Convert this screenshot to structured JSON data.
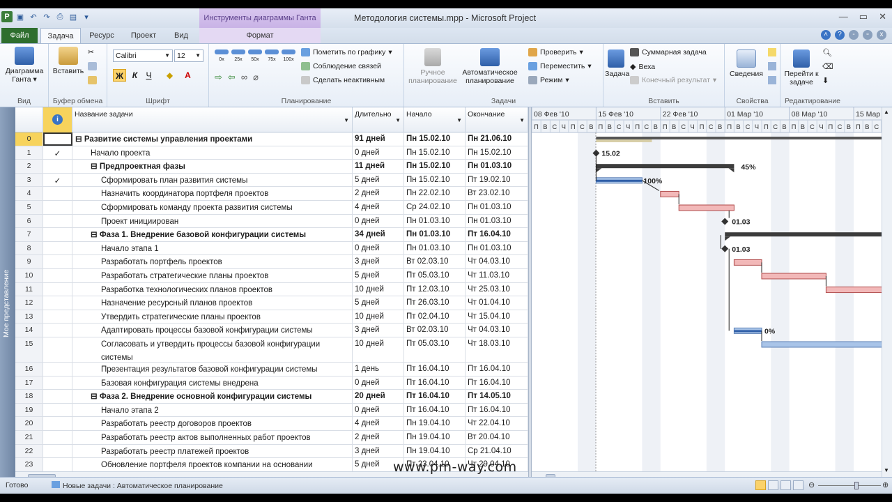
{
  "window": {
    "title": "Методология системы.mpp - Microsoft Project",
    "context_tab_group": "Инструменты диаграммы Ганта"
  },
  "tabs": {
    "file": "Файл",
    "items": [
      "Задача",
      "Ресурс",
      "Проект",
      "Вид",
      "Формат"
    ]
  },
  "ribbon": {
    "view": {
      "btn": "Диаграмма Ганта",
      "label": "Вид"
    },
    "clipboard": {
      "paste": "Вставить",
      "label": "Буфер обмена"
    },
    "font": {
      "name": "Calibri",
      "size": "12",
      "label": "Шрифт",
      "bold": "Ж",
      "italic": "К",
      "underline": "Ч"
    },
    "schedule": {
      "pct": [
        "0x",
        "25x",
        "50x",
        "75x",
        "100x"
      ],
      "mark": "Пометить по графику",
      "respect": "Соблюдение связей",
      "inactive": "Сделать неактивным",
      "label": "Планирование"
    },
    "tasks": {
      "manual": "Ручное планирование",
      "auto": "Автоматическое планирование",
      "inspect": "Проверить",
      "move": "Переместить",
      "mode": "Режим",
      "label": "Задачи"
    },
    "insert": {
      "task": "Задача",
      "summary": "Суммарная задача",
      "milestone": "Веха",
      "deliverable": "Конечный результат",
      "label": "Вставить"
    },
    "properties": {
      "info": "Сведения",
      "label": "Свойства"
    },
    "editing": {
      "goto": "Перейти к задаче",
      "label": "Редактирование"
    }
  },
  "sidebar": {
    "label": "Мое представление"
  },
  "table": {
    "headers": {
      "name": "Название задачи",
      "duration": "Длительно",
      "start": "Начало",
      "finish": "Окончание"
    },
    "rows": [
      {
        "id": "0",
        "ind": "",
        "name": "⊟ Развитие системы управления проектами",
        "dur": "91 дней",
        "start": "Пн 15.02.10",
        "fin": "Пн 21.06.10",
        "lvl": 0,
        "bold": true
      },
      {
        "id": "1",
        "ind": "✓",
        "name": "Начало проекта",
        "dur": "0 дней",
        "start": "Пн 15.02.10",
        "fin": "Пн 15.02.10",
        "lvl": 1,
        "bold": false
      },
      {
        "id": "2",
        "ind": "",
        "name": "⊟ Предпроектная фазы",
        "dur": "11 дней",
        "start": "Пн 15.02.10",
        "fin": "Пн 01.03.10",
        "lvl": 1,
        "bold": true
      },
      {
        "id": "3",
        "ind": "✓",
        "name": "Сформировать план развития системы",
        "dur": "5 дней",
        "start": "Пн 15.02.10",
        "fin": "Пт 19.02.10",
        "lvl": 2,
        "bold": false
      },
      {
        "id": "4",
        "ind": "",
        "name": "Назначить координатора портфеля проектов",
        "dur": "2 дней",
        "start": "Пн 22.02.10",
        "fin": "Вт 23.02.10",
        "lvl": 2,
        "bold": false
      },
      {
        "id": "5",
        "ind": "",
        "name": "Сформировать команду проекта развития системы",
        "dur": "4 дней",
        "start": "Ср 24.02.10",
        "fin": "Пн 01.03.10",
        "lvl": 2,
        "bold": false
      },
      {
        "id": "6",
        "ind": "",
        "name": "Проект инициирован",
        "dur": "0 дней",
        "start": "Пн 01.03.10",
        "fin": "Пн 01.03.10",
        "lvl": 2,
        "bold": false
      },
      {
        "id": "7",
        "ind": "",
        "name": "⊟ Фаза 1. Внедрение базовой конфигурации системы",
        "dur": "34 дней",
        "start": "Пн 01.03.10",
        "fin": "Пт 16.04.10",
        "lvl": 1,
        "bold": true
      },
      {
        "id": "8",
        "ind": "",
        "name": "Начало этапа 1",
        "dur": "0 дней",
        "start": "Пн 01.03.10",
        "fin": "Пн 01.03.10",
        "lvl": 2,
        "bold": false
      },
      {
        "id": "9",
        "ind": "",
        "name": "Разработать портфель проектов",
        "dur": "3 дней",
        "start": "Вт 02.03.10",
        "fin": "Чт 04.03.10",
        "lvl": 2,
        "bold": false
      },
      {
        "id": "10",
        "ind": "",
        "name": "Разработать стратегические планы проектов",
        "dur": "5 дней",
        "start": "Пт 05.03.10",
        "fin": "Чт 11.03.10",
        "lvl": 2,
        "bold": false
      },
      {
        "id": "11",
        "ind": "",
        "name": "Разработка технологических планов проектов",
        "dur": "10 дней",
        "start": "Пт 12.03.10",
        "fin": "Чт 25.03.10",
        "lvl": 2,
        "bold": false
      },
      {
        "id": "12",
        "ind": "",
        "name": "Назначение ресурсный планов проектов",
        "dur": "5 дней",
        "start": "Пт 26.03.10",
        "fin": "Чт 01.04.10",
        "lvl": 2,
        "bold": false
      },
      {
        "id": "13",
        "ind": "",
        "name": "Утвердить стратегические планы проектов",
        "dur": "10 дней",
        "start": "Пт 02.04.10",
        "fin": "Чт 15.04.10",
        "lvl": 2,
        "bold": false
      },
      {
        "id": "14",
        "ind": "",
        "name": "Адаптировать процессы базовой конфигурации системы",
        "dur": "3 дней",
        "start": "Вт 02.03.10",
        "fin": "Чт 04.03.10",
        "lvl": 2,
        "bold": false
      },
      {
        "id": "15",
        "ind": "",
        "name": "Согласовать и утвердить процессы базовой конфигурации системы",
        "dur": "10 дней",
        "start": "Пт 05.03.10",
        "fin": "Чт 18.03.10",
        "lvl": 2,
        "bold": false,
        "tall": true
      },
      {
        "id": "16",
        "ind": "",
        "name": "Презентация результатов базовой конфигурации системы",
        "dur": "1 день",
        "start": "Пт 16.04.10",
        "fin": "Пт 16.04.10",
        "lvl": 2,
        "bold": false
      },
      {
        "id": "17",
        "ind": "",
        "name": "Базовая конфигурация системы внедрена",
        "dur": "0 дней",
        "start": "Пт 16.04.10",
        "fin": "Пт 16.04.10",
        "lvl": 2,
        "bold": false
      },
      {
        "id": "18",
        "ind": "",
        "name": "⊟ Фаза 2. Внедрение основной конфигурации системы",
        "dur": "20 дней",
        "start": "Пт 16.04.10",
        "fin": "Пт 14.05.10",
        "lvl": 1,
        "bold": true
      },
      {
        "id": "19",
        "ind": "",
        "name": "Начало этапа 2",
        "dur": "0 дней",
        "start": "Пт 16.04.10",
        "fin": "Пт 16.04.10",
        "lvl": 2,
        "bold": false
      },
      {
        "id": "20",
        "ind": "",
        "name": "Разработать реестр договоров проектов",
        "dur": "4 дней",
        "start": "Пн 19.04.10",
        "fin": "Чт 22.04.10",
        "lvl": 2,
        "bold": false
      },
      {
        "id": "21",
        "ind": "",
        "name": "Разработать реестр актов выполненных работ проектов",
        "dur": "2 дней",
        "start": "Пн 19.04.10",
        "fin": "Вт 20.04.10",
        "lvl": 2,
        "bold": false
      },
      {
        "id": "22",
        "ind": "",
        "name": "Разработать реестр платежей проектов",
        "dur": "3 дней",
        "start": "Пн 19.04.10",
        "fin": "Ср 21.04.10",
        "lvl": 2,
        "bold": false
      },
      {
        "id": "23",
        "ind": "",
        "name": "Обновление портфеля проектов компании на основании",
        "dur": "5 дней",
        "start": "Пт 23.04.10",
        "fin": "Чт 29.04.10",
        "lvl": 2,
        "bold": false
      }
    ]
  },
  "gantt": {
    "weeks": [
      "08 Фев '10",
      "15 Фев '10",
      "22 Фев '10",
      "01 Мар '10",
      "08 Мар '10",
      "15 Мар"
    ],
    "days": [
      "П",
      "В",
      "С",
      "Ч",
      "П",
      "С",
      "В"
    ],
    "labels": {
      "m1": "15.02",
      "p2": "45%",
      "p3": "100%",
      "m6": "01.03",
      "m8": "01.03",
      "p14": "0%"
    }
  },
  "status": {
    "ready": "Готово",
    "mode": "Новые задачи : Автоматическое планирование"
  },
  "watermark": "www.pm-way.com",
  "colors": {
    "ribbon_active": "#f9c64a",
    "file_tab": "#2e6e2e",
    "summary_bar": "#3c3c3c",
    "task_bar_blue": "#7fa7d8",
    "task_bar_red": "#e28a8a"
  }
}
